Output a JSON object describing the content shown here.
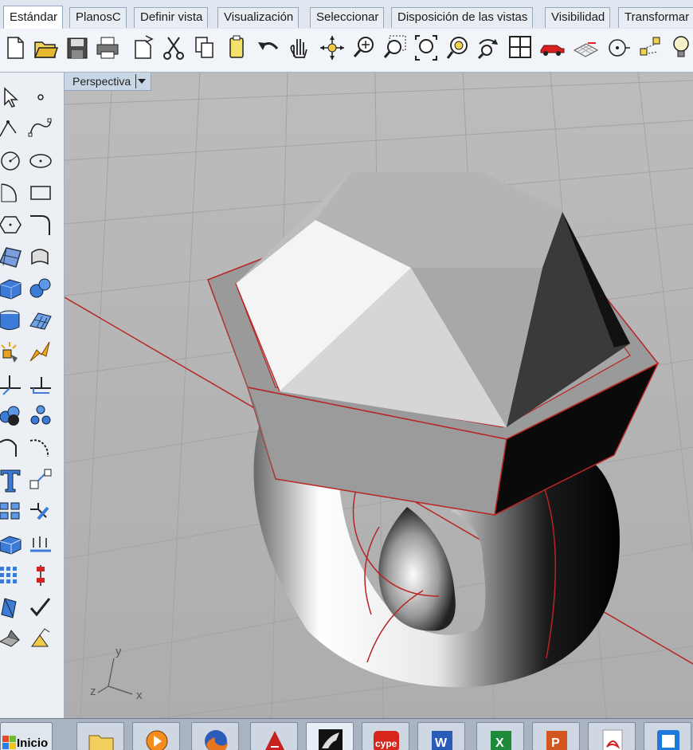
{
  "tabs": [
    "Estándar",
    "PlanosC",
    "Definir vista",
    "Visualización",
    "Seleccionar",
    "Disposición de las vistas",
    "Visibilidad",
    "Transformar"
  ],
  "active_tab": "Estándar",
  "toolbar_icons": [
    "new-file",
    "open-folder",
    "save",
    "print",
    "import",
    "cut",
    "copy",
    "paste",
    "undo",
    "pan",
    "rotate-view",
    "zoom-dynamic",
    "zoom-window",
    "zoom-extents",
    "zoom-selected",
    "rotate-view-2",
    "four-viewports",
    "car-render",
    "plane-grid",
    "point-snap",
    "lights-group",
    "lightbulb"
  ],
  "left_icons": [
    "select-arrow",
    "point",
    "polyline",
    "curve",
    "circle",
    "ellipse",
    "arc",
    "rectangle",
    "polygon",
    "fillet",
    "surface-patch",
    "surface-loft",
    "box-solid",
    "spheres",
    "cylinder",
    "mesh",
    "explode",
    "boolean-split",
    "trim",
    "split",
    "boolean-union",
    "boolean-group",
    "offset",
    "blend-curve",
    "text",
    "scale",
    "array",
    "transform",
    "extrude",
    "points-on",
    "grid",
    "dimension",
    "sweep",
    "check",
    "solid-tools",
    "render-tools"
  ],
  "viewport": {
    "title": "Perspectiva",
    "axis_labels": {
      "x": "x",
      "y": "y",
      "z": "z"
    }
  },
  "taskbar": {
    "start_label": "Inicio",
    "apps": [
      "explorer",
      "media-player",
      "firefox",
      "autocad",
      "rhino",
      "cype",
      "word",
      "excel",
      "powerpoint",
      "acrobat",
      "app"
    ]
  }
}
